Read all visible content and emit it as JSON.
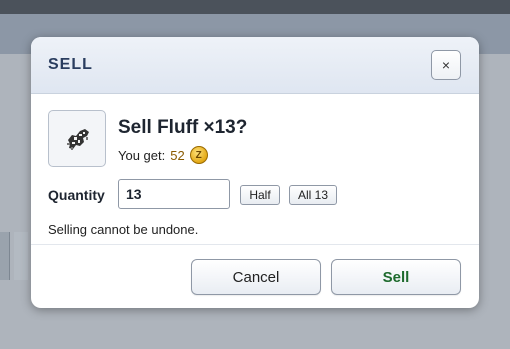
{
  "dialog": {
    "title": "SELL",
    "close_label": "×"
  },
  "item": {
    "icon": "fluff-icon",
    "title": "Sell Fluff ×13?",
    "you_get_label": "You get:",
    "amount": "52",
    "currency_icon_label": "Z"
  },
  "quantity": {
    "label": "Quantity",
    "value": "13",
    "half_label": "Half",
    "all_label": "All 13"
  },
  "warning": "Selling cannot be undone.",
  "actions": {
    "cancel_label": "Cancel",
    "sell_label": "Sell"
  },
  "colors": {
    "title": "#2a3d5f",
    "sell_accent": "#1f6b2e",
    "amount": "#8a5a00"
  }
}
